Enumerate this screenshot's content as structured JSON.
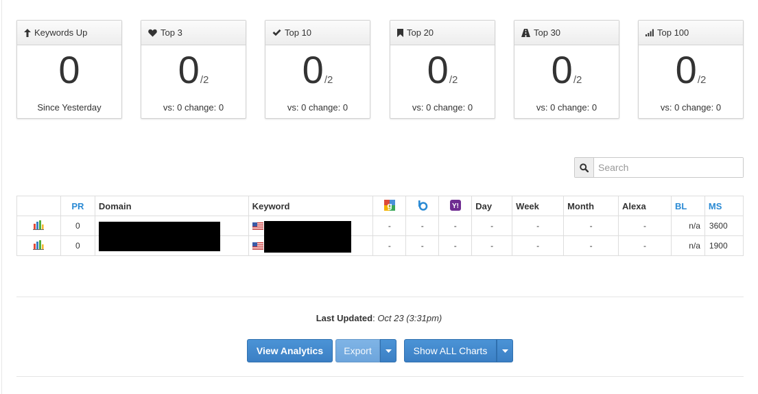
{
  "cards": [
    {
      "title": "Keywords Up",
      "icon": "arrow-up-icon",
      "value": "0",
      "denominator": "",
      "footer": "Since Yesterday"
    },
    {
      "title": "Top 3",
      "icon": "heart-icon",
      "value": "0",
      "denominator": "/2",
      "footer": "vs: 0 change: 0"
    },
    {
      "title": "Top 10",
      "icon": "checkmark-icon",
      "value": "0",
      "denominator": "/2",
      "footer": "vs: 0 change: 0"
    },
    {
      "title": "Top 20",
      "icon": "bookmark-icon",
      "value": "0",
      "denominator": "/2",
      "footer": "vs: 0 change: 0"
    },
    {
      "title": "Top 30",
      "icon": "road-icon",
      "value": "0",
      "denominator": "/2",
      "footer": "vs: 0 change: 0"
    },
    {
      "title": "Top 100",
      "icon": "signal-bars-icon",
      "value": "0",
      "denominator": "/2",
      "footer": "vs: 0 change: 0"
    }
  ],
  "search": {
    "placeholder": "Search",
    "value": ""
  },
  "table": {
    "headers": {
      "pr": "PR",
      "domain": "Domain",
      "keyword": "Keyword",
      "google": "google-icon",
      "bing": "bing-icon",
      "yahoo": "yahoo-icon",
      "day": "Day",
      "week": "Week",
      "month": "Month",
      "alexa": "Alexa",
      "bl": "BL",
      "ms": "MS"
    },
    "rows": [
      {
        "pr": "0",
        "google": "-",
        "bing": "-",
        "yahoo": "-",
        "day": "-",
        "week": "-",
        "month": "-",
        "alexa": "-",
        "bl": "n/a",
        "ms": "3600"
      },
      {
        "pr": "0",
        "google": "-",
        "bing": "-",
        "yahoo": "-",
        "day": "-",
        "week": "-",
        "month": "-",
        "alexa": "-",
        "bl": "n/a",
        "ms": "1900"
      }
    ]
  },
  "footer": {
    "last_updated_label": "Last Updated",
    "last_updated_value": "Oct 23 (3:31pm)",
    "view_analytics": "View Analytics",
    "export": "Export",
    "show_all_charts": "Show ALL Charts"
  },
  "colors": {
    "accent": "#3b7fc4",
    "link": "#2a8ad4"
  }
}
